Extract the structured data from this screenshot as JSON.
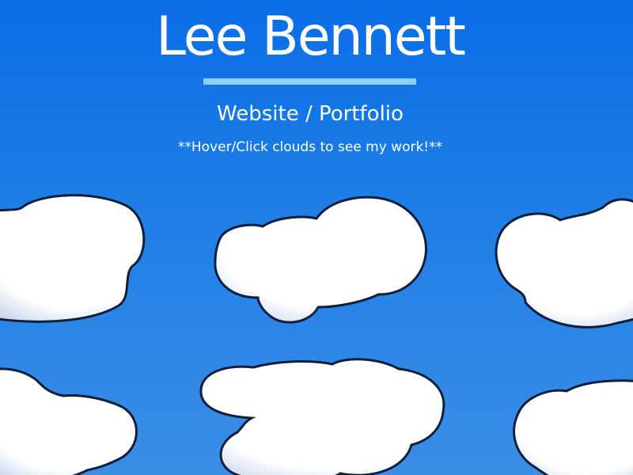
{
  "header": {
    "title": "Lee Bennett",
    "subtitle": "Website / Portfolio",
    "hint": "**Hover/Click clouds to see my work!**"
  },
  "colors": {
    "sky_top": "#0a6de6",
    "sky_bottom": "#3b8ee6",
    "underline": "#8fd0f2",
    "cloud_fill": "#ffffff",
    "cloud_shade": "#c8d8ee",
    "cloud_outline": "#0d1f3a"
  },
  "clouds": [
    {
      "name": "cloud-1"
    },
    {
      "name": "cloud-2"
    },
    {
      "name": "cloud-3"
    },
    {
      "name": "cloud-4"
    },
    {
      "name": "cloud-5"
    },
    {
      "name": "cloud-6"
    }
  ]
}
